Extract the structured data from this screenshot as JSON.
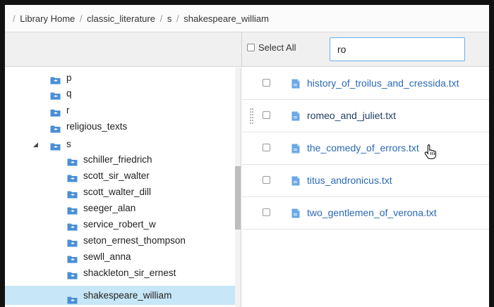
{
  "breadcrumb": {
    "separator": "/",
    "items": [
      "Library Home",
      "classic_literature",
      "s",
      "shakespeare_william"
    ]
  },
  "toolbar": {
    "select_all_label": "Select All",
    "search_value": "ro"
  },
  "tree": {
    "items": [
      {
        "label": "p"
      },
      {
        "label": "q"
      },
      {
        "label": "r"
      },
      {
        "label": "religious_texts"
      },
      {
        "label": "s",
        "toggle": "◢"
      },
      {
        "label": "schiller_friedrich"
      },
      {
        "label": "scott_sir_walter"
      },
      {
        "label": "scott_walter_dill"
      },
      {
        "label": "seeger_alan"
      },
      {
        "label": "service_robert_w"
      },
      {
        "label": "seton_ernest_thompson"
      },
      {
        "label": "sewll_anna"
      },
      {
        "label": "shackleton_sir_ernest"
      },
      {
        "label": "shakespeare_william"
      }
    ]
  },
  "files": [
    {
      "name": "history_of_troilus_and_cressida.txt"
    },
    {
      "name": "romeo_and_juliet.txt"
    },
    {
      "name": "the_comedy_of_errors.txt"
    },
    {
      "name": "titus_andronicus.txt"
    },
    {
      "name": "two_gentlemen_of_verona.txt"
    }
  ],
  "colors": {
    "link": "#2a6ab5",
    "selected_row": "#c7e6f7",
    "folder_icon": "#4a8fd6",
    "search_border": "#6aaee8"
  }
}
